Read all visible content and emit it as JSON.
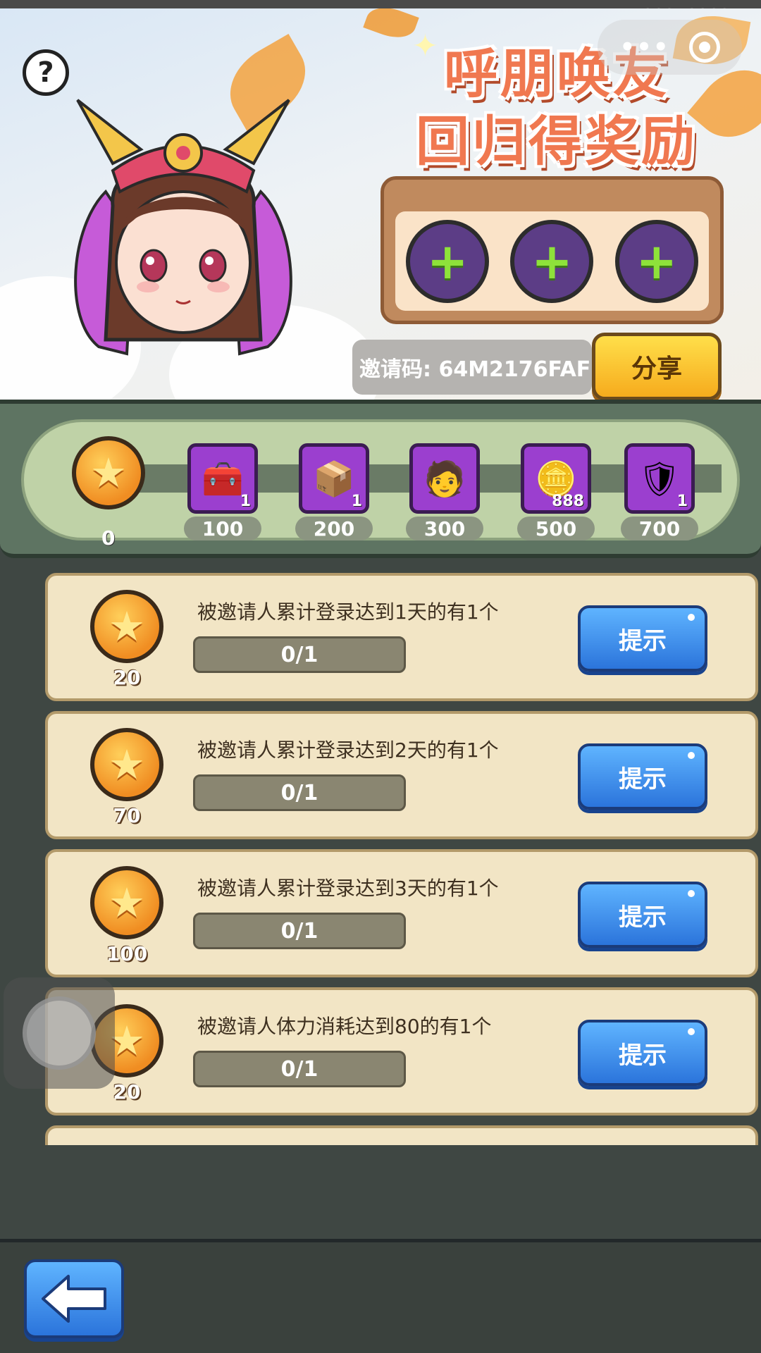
{
  "system": {
    "uid": "10035090351"
  },
  "header": {
    "help_icon_text": "?",
    "title_line1": "呼朋唤友",
    "title_line2": "回归得奖励",
    "invite_code_text": "邀请码: 64M2176FAF",
    "share_label": "分享",
    "friend_slot_symbol": "+",
    "friend_slots": 3
  },
  "progress": {
    "current": "0",
    "current_value": 0,
    "milestones": [
      {
        "label": "100",
        "reward": "chest-upgrade",
        "count": "1"
      },
      {
        "label": "200",
        "reward": "chest-up-arrow",
        "count": "1"
      },
      {
        "label": "300",
        "reward": "hero-avatar",
        "count": ""
      },
      {
        "label": "500",
        "reward": "gold-ingot",
        "count": "888"
      },
      {
        "label": "700",
        "reward": "golden-armor",
        "count": "1"
      }
    ]
  },
  "tasks": [
    {
      "points": "20",
      "desc": "被邀请人累计登录达到1天的有1个",
      "progress": "0/1",
      "button": "提示"
    },
    {
      "points": "70",
      "desc": "被邀请人累计登录达到2天的有1个",
      "progress": "0/1",
      "button": "提示"
    },
    {
      "points": "100",
      "desc": "被邀请人累计登录达到3天的有1个",
      "progress": "0/1",
      "button": "提示"
    },
    {
      "points": "20",
      "desc": "被邀请人体力消耗达到80的有1个",
      "progress": "0/1",
      "button": "提示"
    }
  ],
  "colors": {
    "title": "#f07850",
    "share_button": "#f6ab1d",
    "hint_button": "#2b74db",
    "progress_fill": "#8ac043"
  }
}
